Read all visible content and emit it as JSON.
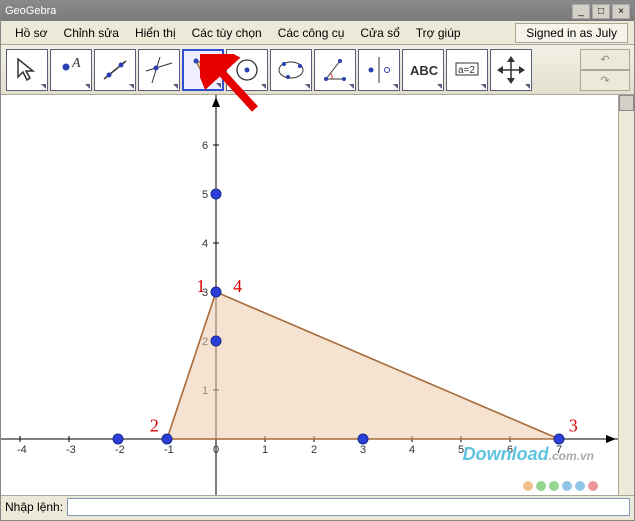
{
  "title": "GeoGebra",
  "window_buttons": {
    "min": "_",
    "max": "□",
    "close": "×"
  },
  "menu": [
    "Hồ sơ",
    "Chỉnh sửa",
    "Hiển thị",
    "Các tùy chọn",
    "Các công cụ",
    "Cửa sổ",
    "Trợ giúp"
  ],
  "signed_in": "Signed in as July",
  "toolbar_icons": [
    "cursor",
    "new-point",
    "line",
    "perp",
    "polygon",
    "circle",
    "conic",
    "angle",
    "reflect",
    "text",
    "slider",
    "move-view"
  ],
  "undo": {
    "undo": "↶",
    "redo": "↷"
  },
  "input_label": "Nhập lệnh:",
  "input_value": "",
  "watermark": {
    "main": "Download",
    "suffix": ".com.vn"
  },
  "chart_data": {
    "type": "scatter",
    "xlabel": "",
    "ylabel": "",
    "xlim": [
      -4,
      8
    ],
    "ylim": [
      -1,
      6.5
    ],
    "xticks": [
      -4,
      -3,
      -2,
      -1,
      0,
      1,
      2,
      3,
      4,
      5,
      6,
      7
    ],
    "yticks": [
      1,
      2,
      3,
      4,
      5,
      6
    ],
    "points": [
      {
        "x": -2,
        "y": 0
      },
      {
        "x": -1,
        "y": 0
      },
      {
        "x": 0,
        "y": 2
      },
      {
        "x": 0,
        "y": 3
      },
      {
        "x": 0,
        "y": 5
      },
      {
        "x": 3,
        "y": 0
      },
      {
        "x": 7,
        "y": 0
      }
    ],
    "triangle_vertices": [
      {
        "x": -1,
        "y": 0
      },
      {
        "x": 7,
        "y": 0
      },
      {
        "x": 0,
        "y": 3
      }
    ],
    "labels_red": [
      {
        "text": "1",
        "x": -0.4,
        "y": 3.0
      },
      {
        "text": "2",
        "x": -1.35,
        "y": 0.15
      },
      {
        "text": "3",
        "x": 7.2,
        "y": 0.15
      },
      {
        "text": "4",
        "x": 0.35,
        "y": 3.0
      }
    ]
  },
  "badge_colors": [
    "#e89a3c",
    "#4fb848",
    "#4fb848",
    "#48a0d8",
    "#48a0d8",
    "#e05058"
  ]
}
